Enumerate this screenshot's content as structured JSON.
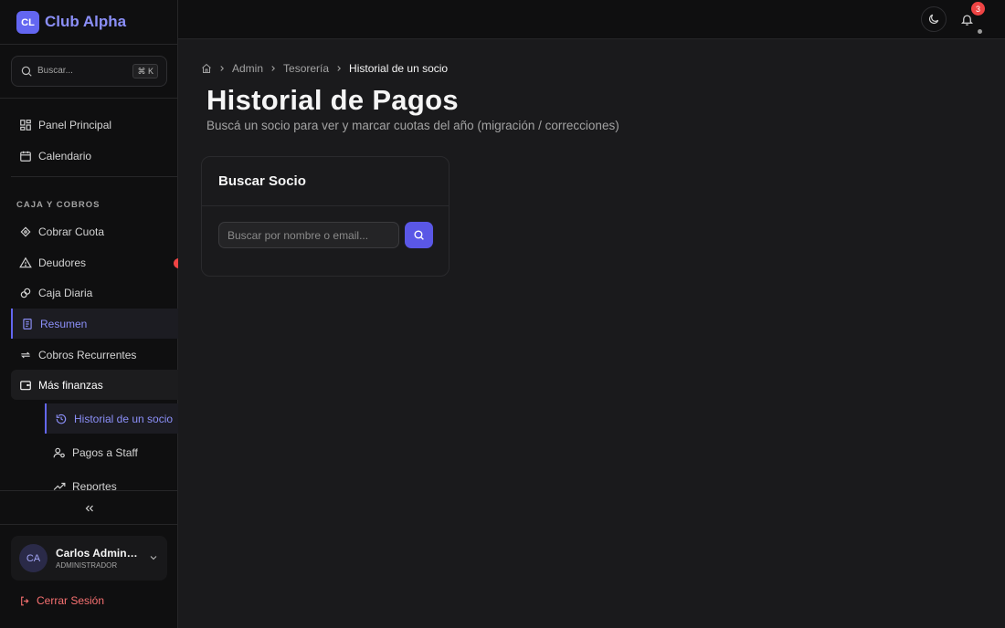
{
  "brand": {
    "logo": "CL",
    "name": "Club Alpha"
  },
  "sidebar_search": {
    "placeholder": "Buscar...",
    "shortcut": "⌘ K"
  },
  "nav": {
    "top": [
      {
        "label": "Panel Principal",
        "icon": "dashboard-icon"
      },
      {
        "label": "Calendario",
        "icon": "calendar-icon"
      }
    ],
    "section_label": "CAJA Y COBROS",
    "items": [
      {
        "label": "Cobrar Cuota",
        "icon": "wallet-icon"
      },
      {
        "label": "Deudores",
        "icon": "alert-icon"
      },
      {
        "label": "Caja Diaria",
        "icon": "coins-icon"
      },
      {
        "label": "Resumen",
        "icon": "receipt-icon"
      },
      {
        "label": "Cobros Recurrentes",
        "icon": "repeat-icon"
      },
      {
        "label": "Más finanzas",
        "icon": "folder-icon"
      }
    ],
    "sub_items": [
      {
        "label": "Historial de un socio",
        "icon": "history-icon"
      },
      {
        "label": "Pagos a Staff",
        "icon": "user-pay-icon"
      },
      {
        "label": "Reportes",
        "icon": "trend-icon"
      }
    ]
  },
  "user": {
    "initials": "CA",
    "name": "Carlos Administrador",
    "role": "ADMINISTRADOR"
  },
  "logout_label": "Cerrar Sesión",
  "topbar": {
    "notifications_count": "3"
  },
  "breadcrumb": {
    "items": [
      "Admin",
      "Tesorería"
    ],
    "current": "Historial de un socio"
  },
  "page": {
    "title": "Historial de Pagos",
    "subtitle": "Buscá un socio para ver y marcar cuotas del año (migración / correcciones)"
  },
  "card": {
    "title": "Buscar Socio",
    "input_placeholder": "Buscar por nombre o email..."
  },
  "colors": {
    "accent": "#6366f1",
    "danger": "#ef4444",
    "background": "#1a1a1c",
    "sidebar": "#0f0f10"
  }
}
